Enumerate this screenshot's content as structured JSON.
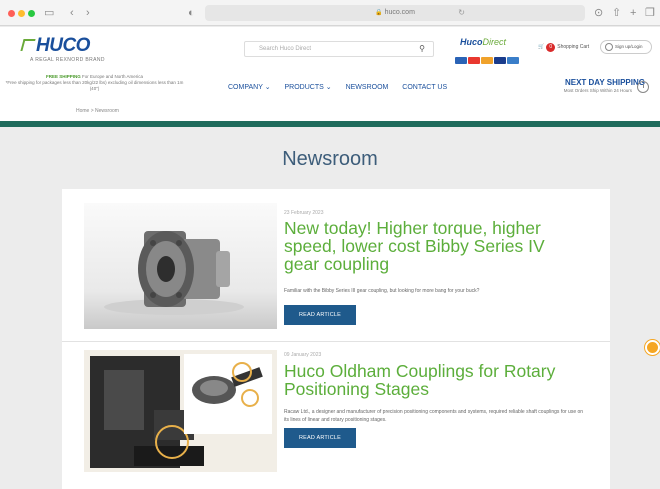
{
  "browser": {
    "url": "huco.com",
    "nav_back": "‹",
    "nav_forward": "›",
    "actions": [
      "⊙",
      "⇧",
      "+",
      "❐"
    ]
  },
  "header": {
    "logo_text": "HUCO",
    "logo_sub": "A REGAL REXNORD BRAND",
    "search_placeholder": "Search Huco Direct",
    "direct_brand": "Huco",
    "direct_brand_light": "Direct",
    "cart_label": "Shopping Cart",
    "cart_count": "0",
    "signin_label": "Sign up/Login",
    "colors": {
      "primary": "#1a4f9c",
      "accent": "#6aaa3a",
      "band": "#1f6b5c"
    }
  },
  "nav": {
    "free_shipping": "FREE SHIPPING",
    "free_shipping_rest": "For Europe and North America",
    "shipping_note": "*Free shipping for packages less than 20kg/22 lbs) excluding oil dimensions less than 1m (40\")",
    "menu": [
      "COMPANY ⌄",
      "PRODUCTS ⌄",
      "NEWSROOM",
      "CONTACT US"
    ],
    "next_day": "NEXT DAY SHIPPING",
    "next_day_sub": "Most Orders Ship Within 24 Hours"
  },
  "breadcrumb": "Home > Newsroom",
  "page_title": "Newsroom",
  "articles": [
    {
      "date": "23 February 2023",
      "title": "New today! Higher torque, higher speed, lower cost Bibby Series IV gear coupling",
      "excerpt": "Familiar with the Bibby Series III gear coupling, but looking for more bang for your buck?",
      "button": "READ ARTICLE"
    },
    {
      "date": "09 January 2023",
      "title": "Huco Oldham Couplings for Rotary Positioning Stages",
      "excerpt": "Racaw Ltd., a designer and manufacturer of precision positioning components and systems, required reliable shaft couplings for use on its lines of linear and rotary positioning stages.",
      "button": "READ ARTICLE"
    }
  ]
}
